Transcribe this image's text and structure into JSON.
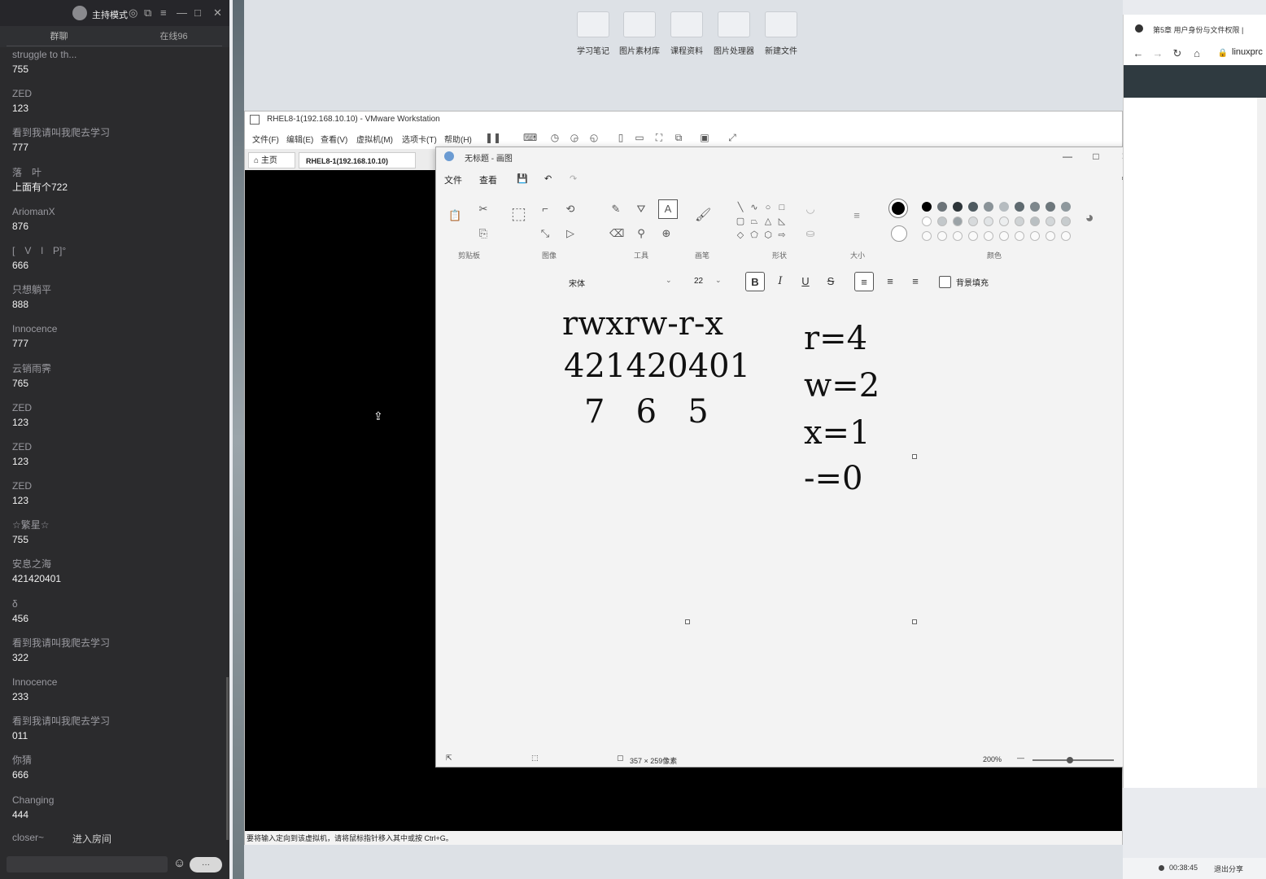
{
  "chat": {
    "mode_label": "主持模式",
    "tabs": [
      "群聊",
      "在线96"
    ],
    "messages": [
      {
        "name": "struggle to th...",
        "text": "755"
      },
      {
        "name": "ZED",
        "text": "123"
      },
      {
        "name": "看到我请叫我爬去学习",
        "text": "777"
      },
      {
        "name": "落　叶",
        "text": "上面有个722"
      },
      {
        "name": "AriomanX",
        "text": "876"
      },
      {
        "name": "[　V　l　P]°",
        "text": "666"
      },
      {
        "name": "只想躺平",
        "text": "888"
      },
      {
        "name": "Innocence",
        "text": "777"
      },
      {
        "name": "云销雨霁",
        "text": "765"
      },
      {
        "name": "ZED",
        "text": "123"
      },
      {
        "name": "ZED",
        "text": "123"
      },
      {
        "name": "ZED",
        "text": "123"
      },
      {
        "name": "☆繁星☆",
        "text": "755"
      },
      {
        "name": "安息之海",
        "text": "421420401"
      },
      {
        "name": "δ",
        "text": "456"
      },
      {
        "name": "看到我请叫我爬去学习",
        "text": "322"
      },
      {
        "name": "Innocence",
        "text": "233"
      },
      {
        "name": "看到我请叫我爬去学习",
        "text": "011"
      },
      {
        "name": "你猜",
        "text": "666"
      },
      {
        "name": "Changing",
        "text": "444"
      }
    ],
    "join_user": "closer~",
    "join_text": "进入房间",
    "send_label": "···"
  },
  "desktop": {
    "icons": [
      "学习笔记",
      "图片素材库",
      "课程资料",
      "图片处理器",
      "新建文件"
    ]
  },
  "vmware": {
    "title": "RHEL8-1(192.168.10.10) - VMware Workstation",
    "menu": [
      "文件(F)",
      "编辑(E)",
      "查看(V)",
      "虚拟机(M)",
      "选项卡(T)",
      "帮助(H)"
    ],
    "tab_home": "主页",
    "tab_vm": "RHEL8-1(192.168.10.10)",
    "status": "要将输入定向到该虚拟机，请将鼠标指针移入其中或按 Ctrl+G。"
  },
  "paint": {
    "title": "无标题 - 画图",
    "menu": [
      "文件",
      "查看"
    ],
    "groups": [
      "剪贴板",
      "图像",
      "工具",
      "画笔",
      "形状",
      "大小",
      "颜色"
    ],
    "font_name": "宋体",
    "font_size": "22",
    "bg_fill_label": "背景填充",
    "canvas_lines": {
      "perm": "rwxrw-r-x",
      "bits": "421420401",
      "octal": "7   6   5",
      "r": "r=4",
      "w": "w=2",
      "x": "x=1",
      "dash": "-=0"
    },
    "canvas_size": "357 × 259像素",
    "zoom": "200%"
  },
  "browser": {
    "tab_title": "第5章 用户身份与文件权限 |",
    "url": "linuxprc"
  },
  "share": {
    "time": "00:38:45",
    "exit_label": "退出分享"
  },
  "colors": {
    "chat_bg": "#2b2b2d",
    "vm_screen": "#000000",
    "paint_bg": "#f3f3f3"
  }
}
